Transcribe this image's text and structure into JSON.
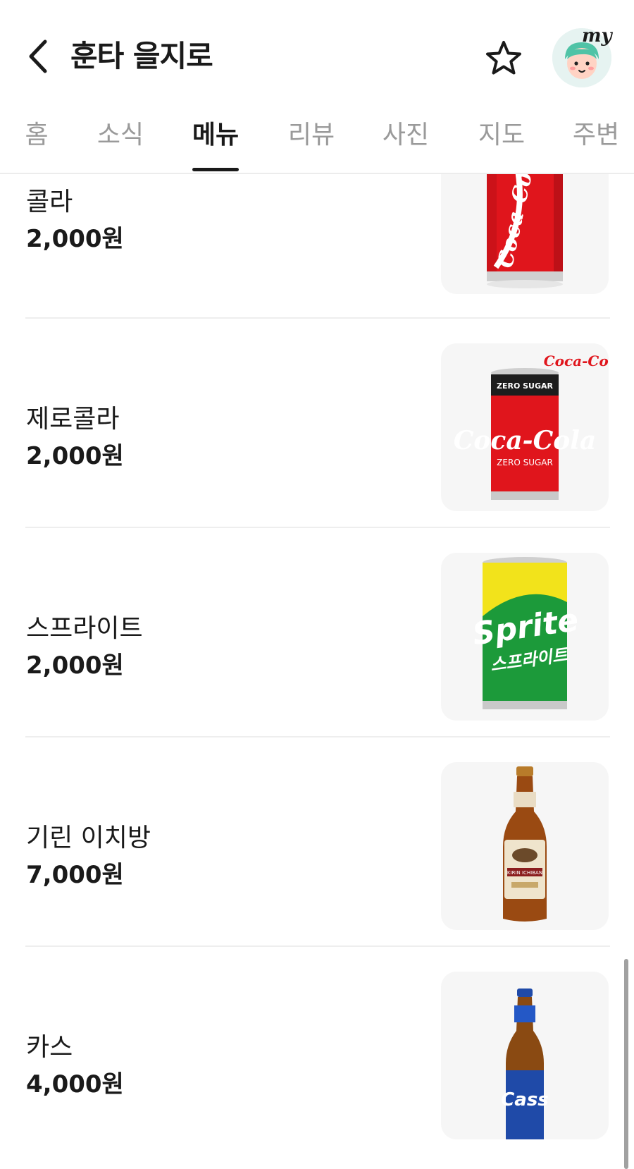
{
  "header": {
    "title": "훈타 을지로",
    "back_icon": "chevron-left-icon",
    "favorite_icon": "star-outline-icon",
    "avatar_label": "my"
  },
  "tabs": [
    {
      "label": "홈",
      "active": false
    },
    {
      "label": "소식",
      "active": false
    },
    {
      "label": "메뉴",
      "active": true
    },
    {
      "label": "리뷰",
      "active": false
    },
    {
      "label": "사진",
      "active": false
    },
    {
      "label": "지도",
      "active": false
    },
    {
      "label": "주변",
      "active": false
    }
  ],
  "menu": {
    "items": [
      {
        "name": "콜라",
        "price": "2,000원"
      },
      {
        "name": "제로콜라",
        "price": "2,000원"
      },
      {
        "name": "스프라이트",
        "price": "2,000원"
      },
      {
        "name": "기린 이치방",
        "price": "7,000원"
      },
      {
        "name": "카스",
        "price": "4,000원"
      }
    ]
  },
  "images": {
    "coke_text": "Coca-Cola",
    "zero_top": "ZERO SUGAR",
    "zero_logo": "Coca-Cola",
    "zero_bottom": "ZERO SUGAR",
    "sprite_text": "Sprite",
    "sprite_kr": "스프라이트",
    "kirin_text": "KIRIN ICHIBAN",
    "cass_text": "Cass"
  },
  "colors": {
    "active_tab": "#1a1a1a",
    "inactive_tab": "#9a9a9a",
    "coke_red": "#e0151c",
    "sprite_green": "#1c9a3a"
  }
}
